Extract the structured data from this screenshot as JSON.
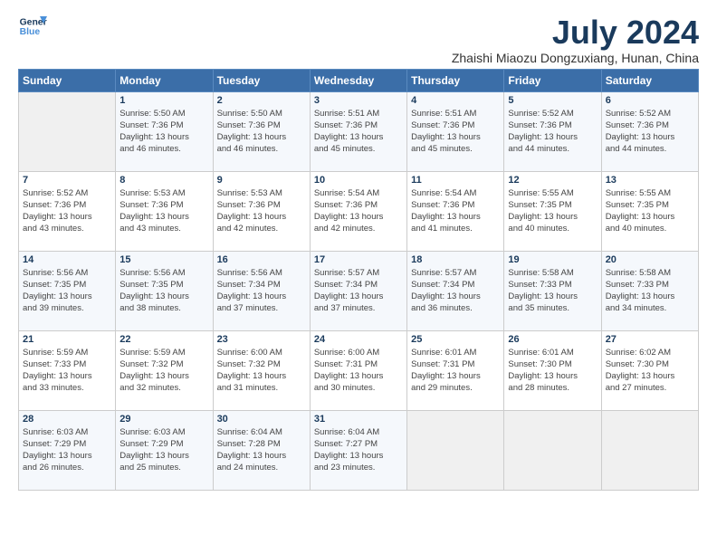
{
  "header": {
    "logo_line1": "General",
    "logo_line2": "Blue",
    "month_year": "July 2024",
    "location": "Zhaishi Miaozu Dongzuxiang, Hunan, China"
  },
  "weekdays": [
    "Sunday",
    "Monday",
    "Tuesday",
    "Wednesday",
    "Thursday",
    "Friday",
    "Saturday"
  ],
  "weeks": [
    [
      {
        "day": "",
        "info": ""
      },
      {
        "day": "1",
        "info": "Sunrise: 5:50 AM\nSunset: 7:36 PM\nDaylight: 13 hours\nand 46 minutes."
      },
      {
        "day": "2",
        "info": "Sunrise: 5:50 AM\nSunset: 7:36 PM\nDaylight: 13 hours\nand 46 minutes."
      },
      {
        "day": "3",
        "info": "Sunrise: 5:51 AM\nSunset: 7:36 PM\nDaylight: 13 hours\nand 45 minutes."
      },
      {
        "day": "4",
        "info": "Sunrise: 5:51 AM\nSunset: 7:36 PM\nDaylight: 13 hours\nand 45 minutes."
      },
      {
        "day": "5",
        "info": "Sunrise: 5:52 AM\nSunset: 7:36 PM\nDaylight: 13 hours\nand 44 minutes."
      },
      {
        "day": "6",
        "info": "Sunrise: 5:52 AM\nSunset: 7:36 PM\nDaylight: 13 hours\nand 44 minutes."
      }
    ],
    [
      {
        "day": "7",
        "info": "Sunrise: 5:52 AM\nSunset: 7:36 PM\nDaylight: 13 hours\nand 43 minutes."
      },
      {
        "day": "8",
        "info": "Sunrise: 5:53 AM\nSunset: 7:36 PM\nDaylight: 13 hours\nand 43 minutes."
      },
      {
        "day": "9",
        "info": "Sunrise: 5:53 AM\nSunset: 7:36 PM\nDaylight: 13 hours\nand 42 minutes."
      },
      {
        "day": "10",
        "info": "Sunrise: 5:54 AM\nSunset: 7:36 PM\nDaylight: 13 hours\nand 42 minutes."
      },
      {
        "day": "11",
        "info": "Sunrise: 5:54 AM\nSunset: 7:36 PM\nDaylight: 13 hours\nand 41 minutes."
      },
      {
        "day": "12",
        "info": "Sunrise: 5:55 AM\nSunset: 7:35 PM\nDaylight: 13 hours\nand 40 minutes."
      },
      {
        "day": "13",
        "info": "Sunrise: 5:55 AM\nSunset: 7:35 PM\nDaylight: 13 hours\nand 40 minutes."
      }
    ],
    [
      {
        "day": "14",
        "info": "Sunrise: 5:56 AM\nSunset: 7:35 PM\nDaylight: 13 hours\nand 39 minutes."
      },
      {
        "day": "15",
        "info": "Sunrise: 5:56 AM\nSunset: 7:35 PM\nDaylight: 13 hours\nand 38 minutes."
      },
      {
        "day": "16",
        "info": "Sunrise: 5:56 AM\nSunset: 7:34 PM\nDaylight: 13 hours\nand 37 minutes."
      },
      {
        "day": "17",
        "info": "Sunrise: 5:57 AM\nSunset: 7:34 PM\nDaylight: 13 hours\nand 37 minutes."
      },
      {
        "day": "18",
        "info": "Sunrise: 5:57 AM\nSunset: 7:34 PM\nDaylight: 13 hours\nand 36 minutes."
      },
      {
        "day": "19",
        "info": "Sunrise: 5:58 AM\nSunset: 7:33 PM\nDaylight: 13 hours\nand 35 minutes."
      },
      {
        "day": "20",
        "info": "Sunrise: 5:58 AM\nSunset: 7:33 PM\nDaylight: 13 hours\nand 34 minutes."
      }
    ],
    [
      {
        "day": "21",
        "info": "Sunrise: 5:59 AM\nSunset: 7:33 PM\nDaylight: 13 hours\nand 33 minutes."
      },
      {
        "day": "22",
        "info": "Sunrise: 5:59 AM\nSunset: 7:32 PM\nDaylight: 13 hours\nand 32 minutes."
      },
      {
        "day": "23",
        "info": "Sunrise: 6:00 AM\nSunset: 7:32 PM\nDaylight: 13 hours\nand 31 minutes."
      },
      {
        "day": "24",
        "info": "Sunrise: 6:00 AM\nSunset: 7:31 PM\nDaylight: 13 hours\nand 30 minutes."
      },
      {
        "day": "25",
        "info": "Sunrise: 6:01 AM\nSunset: 7:31 PM\nDaylight: 13 hours\nand 29 minutes."
      },
      {
        "day": "26",
        "info": "Sunrise: 6:01 AM\nSunset: 7:30 PM\nDaylight: 13 hours\nand 28 minutes."
      },
      {
        "day": "27",
        "info": "Sunrise: 6:02 AM\nSunset: 7:30 PM\nDaylight: 13 hours\nand 27 minutes."
      }
    ],
    [
      {
        "day": "28",
        "info": "Sunrise: 6:03 AM\nSunset: 7:29 PM\nDaylight: 13 hours\nand 26 minutes."
      },
      {
        "day": "29",
        "info": "Sunrise: 6:03 AM\nSunset: 7:29 PM\nDaylight: 13 hours\nand 25 minutes."
      },
      {
        "day": "30",
        "info": "Sunrise: 6:04 AM\nSunset: 7:28 PM\nDaylight: 13 hours\nand 24 minutes."
      },
      {
        "day": "31",
        "info": "Sunrise: 6:04 AM\nSunset: 7:27 PM\nDaylight: 13 hours\nand 23 minutes."
      },
      {
        "day": "",
        "info": ""
      },
      {
        "day": "",
        "info": ""
      },
      {
        "day": "",
        "info": ""
      }
    ]
  ]
}
